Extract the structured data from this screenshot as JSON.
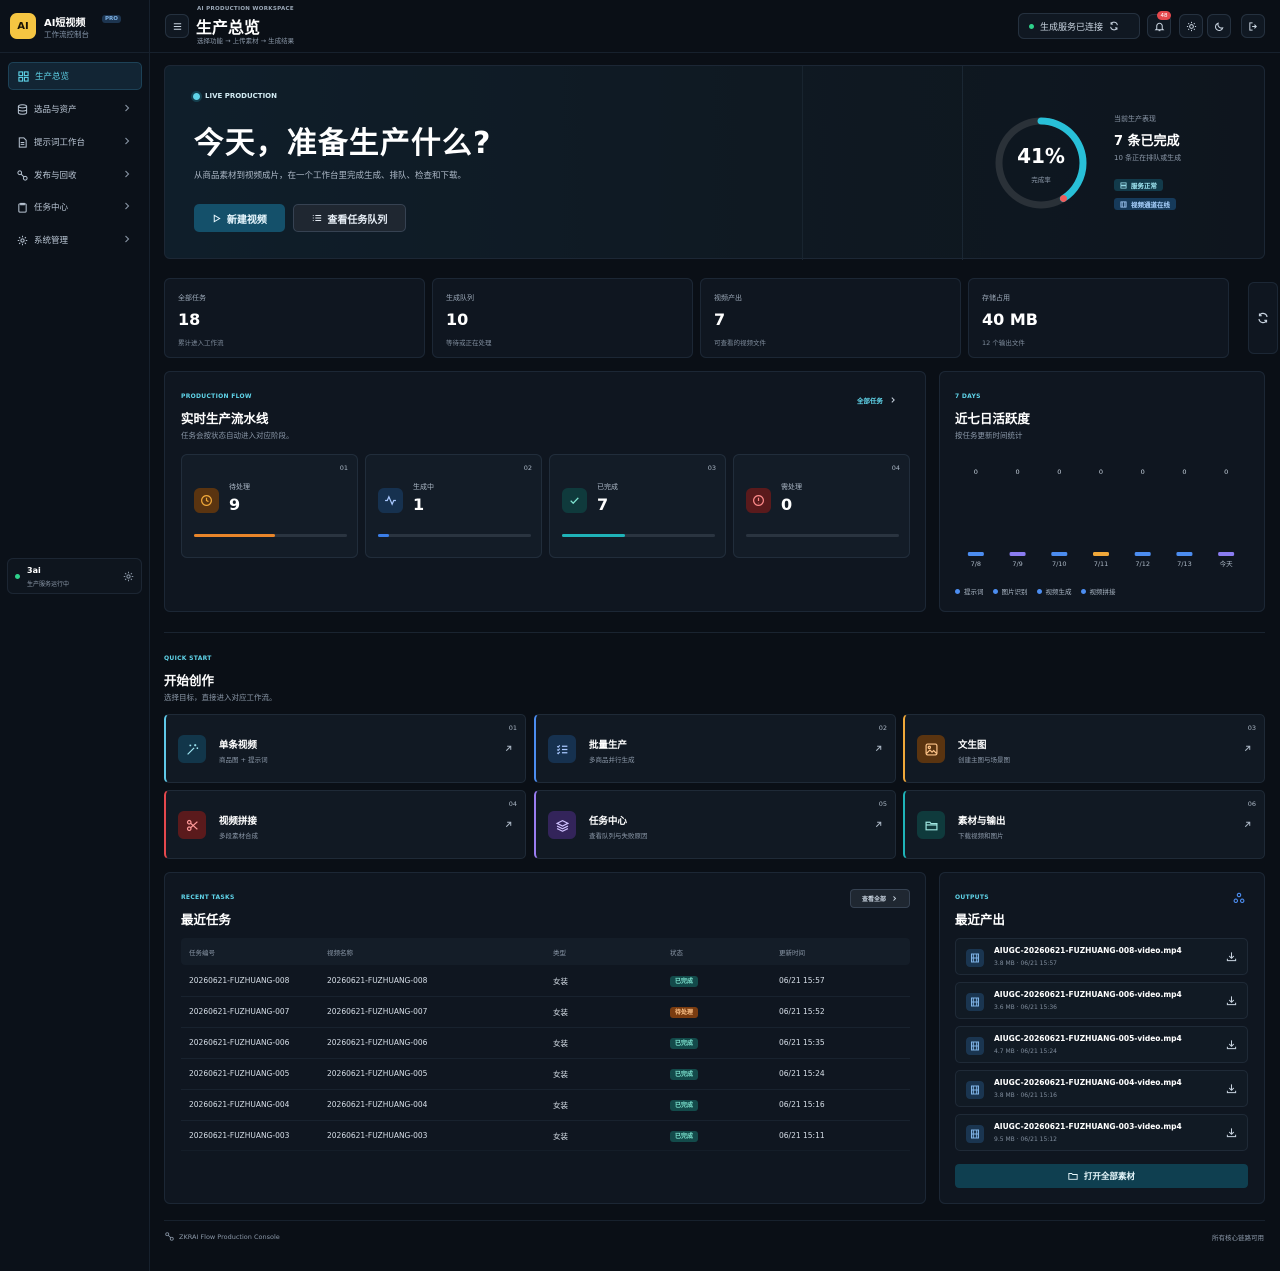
{
  "app": {
    "logo_text": "AI",
    "name": "AI短视频",
    "badge": "PRO",
    "subtitle": "工作流控制台"
  },
  "sidebar": {
    "items": [
      {
        "label": "生产总览",
        "icon": "grid-icon",
        "active": true
      },
      {
        "label": "选品与资产",
        "icon": "database-icon"
      },
      {
        "label": "提示词工作台",
        "icon": "document-icon"
      },
      {
        "label": "发布与回收",
        "icon": "link-icon"
      },
      {
        "label": "任务中心",
        "icon": "clipboard-icon"
      },
      {
        "label": "系统管理",
        "icon": "gear-icon"
      }
    ],
    "user": {
      "name": "3ai",
      "status": "生产服务运行中"
    }
  },
  "header": {
    "kicker": "AI PRODUCTION WORKSPACE",
    "title": "生产总览",
    "subtitle": "选择功能 → 上传素材 → 生成结果",
    "connection": "生成服务已连接",
    "notification_count": "48"
  },
  "hero": {
    "live": "LIVE PRODUCTION",
    "title": "今天，准备生产什么?",
    "description": "从商品素材到视频成片，在一个工作台里完成生成、排队、检查和下载。",
    "primary_button": "新建视频",
    "secondary_button": "查看任务队列",
    "progress_percent": "41%",
    "progress_value": 0.41,
    "progress_label": "完成率",
    "perf_label": "当前生产表现",
    "perf_value": "7 条已完成",
    "perf_sub": "10 条正在排队或生成",
    "status_badges": [
      "服务正常",
      "视频通道在线"
    ]
  },
  "stats": [
    {
      "label": "全部任务",
      "value": "18",
      "sub": "累计进入工作流"
    },
    {
      "label": "生成队列",
      "value": "10",
      "sub": "等待或正在处理"
    },
    {
      "label": "视频产出",
      "value": "7",
      "sub": "可查看的视频文件"
    },
    {
      "label": "存储占用",
      "value": "40 MB",
      "sub": "12 个输出文件"
    }
  ],
  "flow": {
    "kicker": "PRODUCTION FLOW",
    "title": "实时生产流水线",
    "subtitle": "任务会按状态自动进入对应阶段。",
    "link": "全部任务",
    "stages": [
      {
        "num": "01",
        "label": "待处理",
        "value": "9",
        "progress": 0.53,
        "color": "#e8852a",
        "icon": "clock-icon",
        "bg": "#5a3410"
      },
      {
        "num": "02",
        "label": "生成中",
        "value": "1",
        "progress": 0.07,
        "color": "#3b7ee8",
        "icon": "activity-icon",
        "bg": "#16314f"
      },
      {
        "num": "03",
        "label": "已完成",
        "value": "7",
        "progress": 0.41,
        "color": "#1fb3b8",
        "icon": "check-icon",
        "bg": "#0f3a3c"
      },
      {
        "num": "04",
        "label": "需处理",
        "value": "0",
        "progress": 0,
        "color": "#e5484d",
        "icon": "alert-icon",
        "bg": "#5a1a1c"
      }
    ]
  },
  "activity": {
    "kicker": "7 DAYS",
    "title": "近七日活跃度",
    "subtitle": "按任务更新时间统计",
    "chart_data": {
      "type": "bar",
      "categories": [
        "7/8",
        "7/9",
        "7/10",
        "7/11",
        "7/12",
        "7/13",
        "今天"
      ],
      "values": [
        0,
        0,
        0,
        0,
        0,
        0,
        0
      ],
      "colors": [
        "#4c8df0",
        "#8a7cf0",
        "#4c8df0",
        "#f0a83a",
        "#4c8df0",
        "#4c8df0",
        "#8a7cf0"
      ]
    },
    "legend": [
      {
        "label": "提示词",
        "color": "#4c8df0"
      },
      {
        "label": "图片识别",
        "color": "#4c8df0"
      },
      {
        "label": "视频生成",
        "color": "#4c8df0"
      },
      {
        "label": "视频拼接",
        "color": "#4c8df0"
      }
    ]
  },
  "quickstart": {
    "kicker": "QUICK START",
    "title": "开始创作",
    "subtitle": "选择目标，直接进入对应工作流。",
    "cards": [
      {
        "num": "01",
        "title": "单条视频",
        "desc": "商品图 + 提示词",
        "icon": "magic-wand-icon",
        "color": "#5fc8e8",
        "bg": "#12364a"
      },
      {
        "num": "02",
        "title": "批量生产",
        "desc": "多商品并行生成",
        "icon": "list-check-icon",
        "color": "#4c8df0",
        "bg": "#16314f"
      },
      {
        "num": "03",
        "title": "文生图",
        "desc": "创建主图与场景图",
        "icon": "image-icon",
        "color": "#f0a83a",
        "bg": "#5a3410"
      },
      {
        "num": "04",
        "title": "视频拼接",
        "desc": "多段素材合成",
        "icon": "scissors-icon",
        "color": "#e5484d",
        "bg": "#5a1a1c"
      },
      {
        "num": "05",
        "title": "任务中心",
        "desc": "查看队列与失败原因",
        "icon": "layers-icon",
        "color": "#9a7cf0",
        "bg": "#33245a"
      },
      {
        "num": "06",
        "title": "素材与输出",
        "desc": "下载视频和图片",
        "icon": "folder-icon",
        "color": "#1fb3b8",
        "bg": "#0f3a3c"
      }
    ]
  },
  "recent": {
    "kicker": "RECENT TASKS",
    "title": "最近任务",
    "view_all": "查看全部",
    "columns": [
      "任务编号",
      "视频名称",
      "类型",
      "状态",
      "更新时间"
    ],
    "rows": [
      {
        "id": "20260621-FUZHUANG-008",
        "name": "20260621-FUZHUANG-008",
        "type": "女装",
        "status": "已完成",
        "state": "done",
        "time": "06/21 15:57"
      },
      {
        "id": "20260621-FUZHUANG-007",
        "name": "20260621-FUZHUANG-007",
        "type": "女装",
        "status": "待处理",
        "state": "pend",
        "time": "06/21 15:52"
      },
      {
        "id": "20260621-FUZHUANG-006",
        "name": "20260621-FUZHUANG-006",
        "type": "女装",
        "status": "已完成",
        "state": "done",
        "time": "06/21 15:35"
      },
      {
        "id": "20260621-FUZHUANG-005",
        "name": "20260621-FUZHUANG-005",
        "type": "女装",
        "status": "已完成",
        "state": "done",
        "time": "06/21 15:24"
      },
      {
        "id": "20260621-FUZHUANG-004",
        "name": "20260621-FUZHUANG-004",
        "type": "女装",
        "status": "已完成",
        "state": "done",
        "time": "06/21 15:16"
      },
      {
        "id": "20260621-FUZHUANG-003",
        "name": "20260621-FUZHUANG-003",
        "type": "女装",
        "status": "已完成",
        "state": "done",
        "time": "06/21 15:11"
      }
    ]
  },
  "outputs": {
    "kicker": "OUTPUTS",
    "title": "最近产出",
    "open_all": "打开全部素材",
    "files": [
      {
        "name": "AIUGC-20260621-FUZHUANG-008-video.mp4",
        "meta": "3.8 MB · 06/21 15:57"
      },
      {
        "name": "AIUGC-20260621-FUZHUANG-006-video.mp4",
        "meta": "3.6 MB · 06/21 15:36"
      },
      {
        "name": "AIUGC-20260621-FUZHUANG-005-video.mp4",
        "meta": "4.7 MB · 06/21 15:24"
      },
      {
        "name": "AIUGC-20260621-FUZHUANG-004-video.mp4",
        "meta": "3.8 MB · 06/21 15:16"
      },
      {
        "name": "AIUGC-20260621-FUZHUANG-003-video.mp4",
        "meta": "9.5 MB · 06/21 15:12"
      }
    ]
  },
  "footer": {
    "left": "ZKRAI Flow Production Console",
    "right": "所有核心链路可用"
  }
}
